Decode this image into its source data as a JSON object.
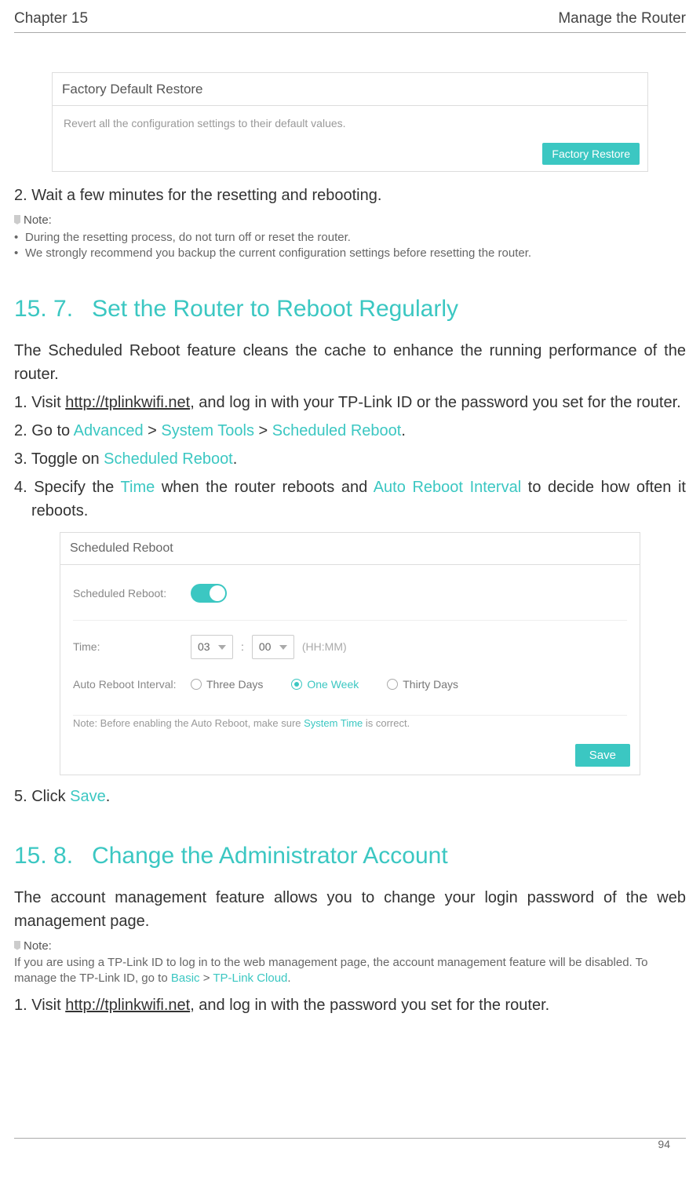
{
  "header": {
    "left": "Chapter 15",
    "right": "Manage the Router"
  },
  "panel_factory": {
    "title": "Factory Default Restore",
    "desc": "Revert all the configuration settings to their default values.",
    "button": "Factory Restore"
  },
  "step_a2": "2. Wait a few minutes for the resetting and rebooting.",
  "note_label": "Note:",
  "note_a_items": [
    "During the resetting process, do not turn off or reset the router.",
    "We strongly recommend you backup the current configuration settings before resetting the router."
  ],
  "section157": {
    "num": "15. 7.",
    "title": "Set the Router to Reboot Regularly",
    "intro": "The Scheduled Reboot feature cleans the cache to enhance the running performance of the router.",
    "steps": {
      "s1_pre": "1. Visit ",
      "s1_link": "http://tplinkwifi.net",
      "s1_post": ", and log in with your TP-Link ID or the password you set for the router.",
      "s2_pre": "2. Go to ",
      "s2_a": "Advanced",
      "s2_b": "System Tools",
      "s2_c": "Scheduled Reboot",
      "gt": " > ",
      "dot": ".",
      "s3_pre": "3. Toggle on ",
      "s3_a": "Scheduled Reboot",
      "s4_pre": "4. Specify the ",
      "s4_a": "Time",
      "s4_mid": " when the router reboots and ",
      "s4_b": "Auto Reboot Interval",
      "s4_post": " to decide how often it reboots."
    }
  },
  "panel_sched": {
    "title": "Scheduled Reboot",
    "label_toggle": "Scheduled Reboot:",
    "label_time": "Time:",
    "hour": "03",
    "minute": "00",
    "colon": ":",
    "hhmm": "(HH:MM)",
    "label_interval": "Auto Reboot Interval:",
    "opt1": "Three Days",
    "opt2": "One Week",
    "opt3": "Thirty Days",
    "note_pre": "Note:  Before enabling the Auto Reboot, make sure ",
    "note_link": "System Time",
    "note_post": " is correct.",
    "save": "Save"
  },
  "step_b5_pre": "5. Click ",
  "step_b5_a": "Save",
  "section158": {
    "num": "15. 8.",
    "title": "Change the Administrator Account",
    "intro": "The account management feature allows you to change your login password of the web management page.",
    "note_pre": "If you are using a TP-Link ID to log in to the web management page, the account management feature will be disabled. To manage the TP-Link ID, go to ",
    "note_a": "Basic",
    "note_b": "TP-Link Cloud",
    "gt": " > ",
    "dot": ".",
    "s1_pre": "1. Visit ",
    "s1_link": "http://tplinkwifi.net",
    "s1_post": ", and log in with the password you set for the router."
  },
  "page_number": "94"
}
